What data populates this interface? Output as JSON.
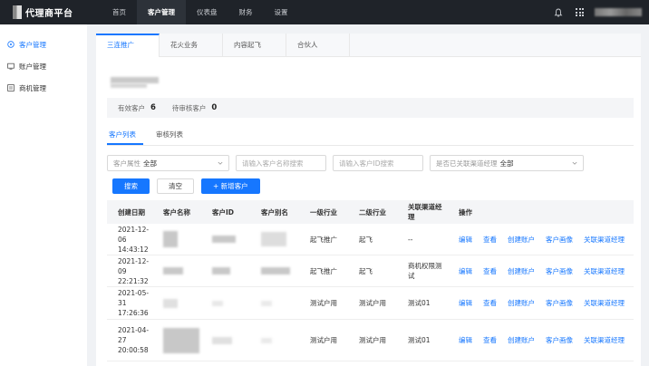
{
  "topbar": {
    "logo_text": "代理商平台",
    "nav": [
      "首页",
      "客户管理",
      "仪表盘",
      "财务",
      "设置"
    ],
    "active_nav": 1
  },
  "sidebar": {
    "items": [
      {
        "label": "客户管理",
        "icon": "customer-icon",
        "active": true
      },
      {
        "label": "账户管理",
        "icon": "account-icon",
        "active": false
      },
      {
        "label": "商机管理",
        "icon": "opportunity-icon",
        "active": false
      }
    ]
  },
  "tabs": [
    "三连推广",
    "花火业务",
    "内容起飞",
    "合伙人"
  ],
  "stats": {
    "valid_label": "有效客户",
    "valid_value": "6",
    "pending_label": "待审核客户",
    "pending_value": "0"
  },
  "sub_tabs": [
    "客户列表",
    "审核列表"
  ],
  "filters": {
    "attr_label": "客户属性",
    "attr_value": "全部",
    "name_placeholder": "请输入客户名称搜索",
    "id_placeholder": "请输入客户ID搜索",
    "manager_label": "是否已关联渠道经理",
    "manager_value": "全部"
  },
  "buttons": {
    "search": "搜索",
    "clear": "清空",
    "add": "+ 新增客户"
  },
  "table": {
    "headers": [
      "创建日期",
      "客户名称",
      "客户ID",
      "客户别名",
      "一级行业",
      "二级行业",
      "关联渠道经理",
      "操作"
    ],
    "rows": [
      {
        "date": "2021-12-06",
        "time": "14:43:12",
        "ind1": "起飞推广",
        "ind2": "起飞",
        "manager": "--",
        "ops": [
          "编辑",
          "查看",
          "创建账户",
          "客户画像",
          "关联渠道经理"
        ]
      },
      {
        "date": "2021-12-09",
        "time": "22:21:32",
        "ind1": "起飞推广",
        "ind2": "起飞",
        "manager": "商机权限测试",
        "ops": [
          "编辑",
          "查看",
          "创建账户",
          "客户画像",
          "关联渠道经理"
        ]
      },
      {
        "date": "2021-05-31",
        "time": "17:26:36",
        "ind1": "测试户用",
        "ind2": "测试户用",
        "manager": "测试01",
        "ops": [
          "编辑",
          "查看",
          "创建账户",
          "客户画像",
          "关联渠道经理"
        ]
      },
      {
        "date": "2021-04-27",
        "time": "20:00:58",
        "ind1": "测试户用",
        "ind2": "测试户用",
        "manager": "测试01",
        "ops": [
          "编辑",
          "查看",
          "创建账户",
          "客户画像",
          "关联渠道经理"
        ]
      }
    ]
  },
  "colors": {
    "accent": "#1677ff",
    "topbar": "#1f2329"
  }
}
